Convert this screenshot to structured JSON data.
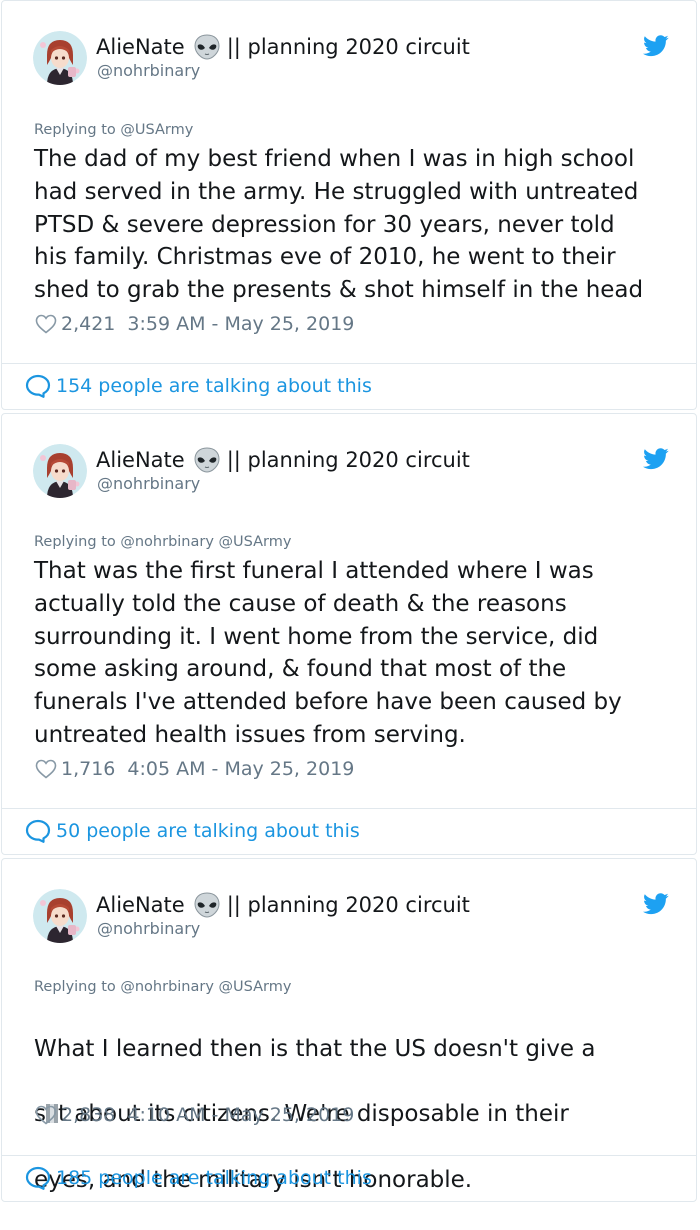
{
  "tweets": [
    {
      "display_name": "AlieNate",
      "name_suffix": "|| planning 2020 circuit",
      "handle": "@nohrbinary",
      "replying_to": "Replying to @USArmy",
      "text": "The dad of my best friend when I was in high school\nhad served in the army. He struggled with untreated\nPTSD & severe depression for 30 years, never told\nhis family. Christmas eve of 2010, he went to their\nshed to grab the presents & shot himself in the head",
      "likes": "2,421",
      "timestamp": "3:59 AM - May 25, 2019",
      "talking": "154 people are talking about this"
    },
    {
      "display_name": "AlieNate",
      "name_suffix": "|| planning 2020 circuit",
      "handle": "@nohrbinary",
      "replying_to": "Replying to @nohrbinary @USArmy",
      "text": "That was the first funeral I attended where I was\nactually told the cause of death & the reasons\nsurrounding it. I went home from the service, did\nsome asking around, & found that most of the\nfunerals I've attended before have been caused by\nuntreated  health issues from serving.",
      "likes": "1,716",
      "timestamp": "4:05 AM - May 25, 2019",
      "talking": "50 people are talking about this"
    },
    {
      "display_name": "AlieNate",
      "name_suffix": "|| planning 2020 circuit",
      "handle": "@nohrbinary",
      "replying_to": "Replying to @nohrbinary @USArmy",
      "text_line1": "What I learned then is that the US doesn't give a",
      "text_line2_pre": "s",
      "text_line2_post": "t about its citizens. We're disposable in their",
      "text_line3": "eyes, and the military isn't honorable.",
      "likes": "2,838",
      "timestamp": "4:10 AM - May 25, 2019",
      "talking": "185 people are talking about this"
    }
  ],
  "icons": {
    "alien": "alien-emoji-icon",
    "twitter": "twitter-bird-icon",
    "heart": "heart-icon",
    "reply_bubble": "speech-bubble-icon"
  },
  "colors": {
    "text": "#14171a",
    "secondary": "#657786",
    "link": "#1b95e0",
    "twitter_blue": "#1da1f2",
    "border": "#e1e8ed"
  }
}
